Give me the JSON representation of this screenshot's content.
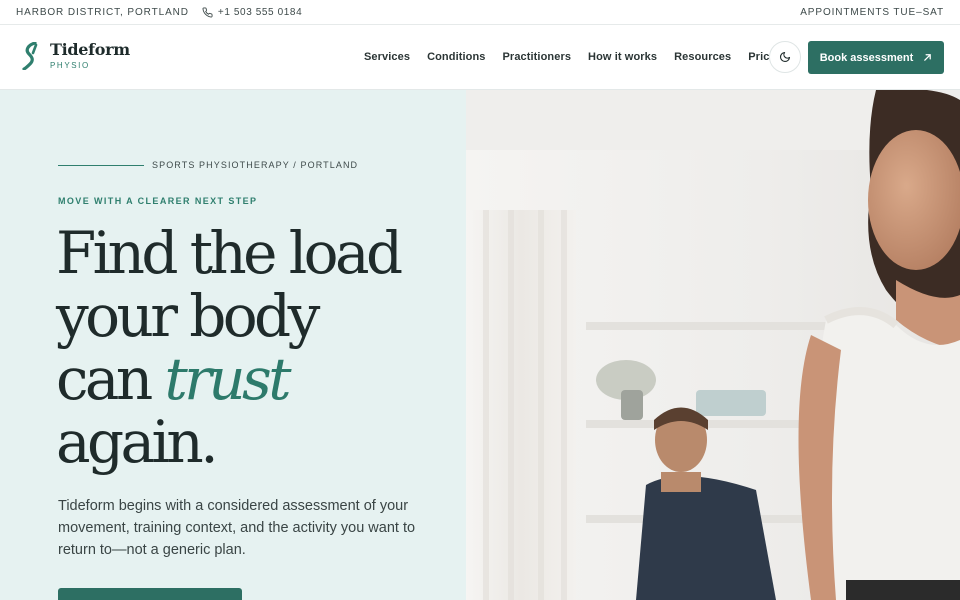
{
  "topbar": {
    "location": "HARBOR DISTRICT, PORTLAND",
    "phone": "+1 503 555 0184",
    "hours": "APPOINTMENTS TUE–SAT"
  },
  "brand": {
    "name": "Tideform",
    "sub": "PHYSIO"
  },
  "nav": {
    "items": [
      "Services",
      "Conditions",
      "Practitioners",
      "How it works",
      "Resources",
      "Pricing"
    ]
  },
  "header": {
    "book_label": "Book assessment"
  },
  "hero": {
    "eyebrow": "SPORTS PHYSIOTHERAPY / PORTLAND",
    "kicker": "MOVE WITH A CLEARER NEXT STEP",
    "headline_1": "Find the load",
    "headline_2": "your body",
    "headline_3a": "can",
    "headline_3b": "trust",
    "headline_4": "again.",
    "lede": "Tideform begins with a considered assessment of your movement, training context, and the activity you want to return to—not a generic plan."
  },
  "colors": {
    "accent": "#2d6f63",
    "accent_text": "#2f7f6e",
    "hero_bg": "#e6f2f1",
    "ink": "#1f2b2b"
  },
  "icons": {
    "phone": "phone-icon",
    "theme": "moon-icon",
    "book": "arrow-up-right-icon",
    "logo": "wave-s-logo-icon"
  }
}
